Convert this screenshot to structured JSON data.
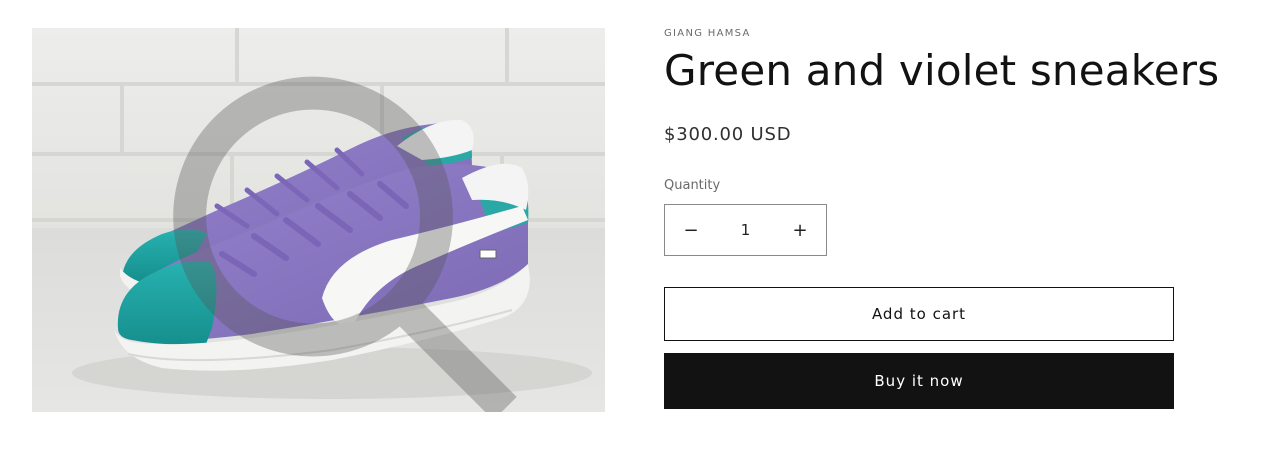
{
  "product": {
    "vendor": "GIANG HAMSA",
    "title": "Green and violet sneakers",
    "price": "$300.00 USD",
    "image_alt": "Green and violet sneakers",
    "image_subject": "purple suede sneakers with teal toe and white stripe against white brick wall"
  },
  "quantity": {
    "label": "Quantity",
    "value": "1",
    "decrease_symbol": "−",
    "increase_symbol": "+"
  },
  "buttons": {
    "add_to_cart": "Add to cart",
    "buy_now": "Buy it now"
  },
  "colors": {
    "primary": "#121212",
    "shoe_violet": "#8e7cc3",
    "shoe_teal": "#1fa6a5",
    "background": "#ffffff"
  }
}
